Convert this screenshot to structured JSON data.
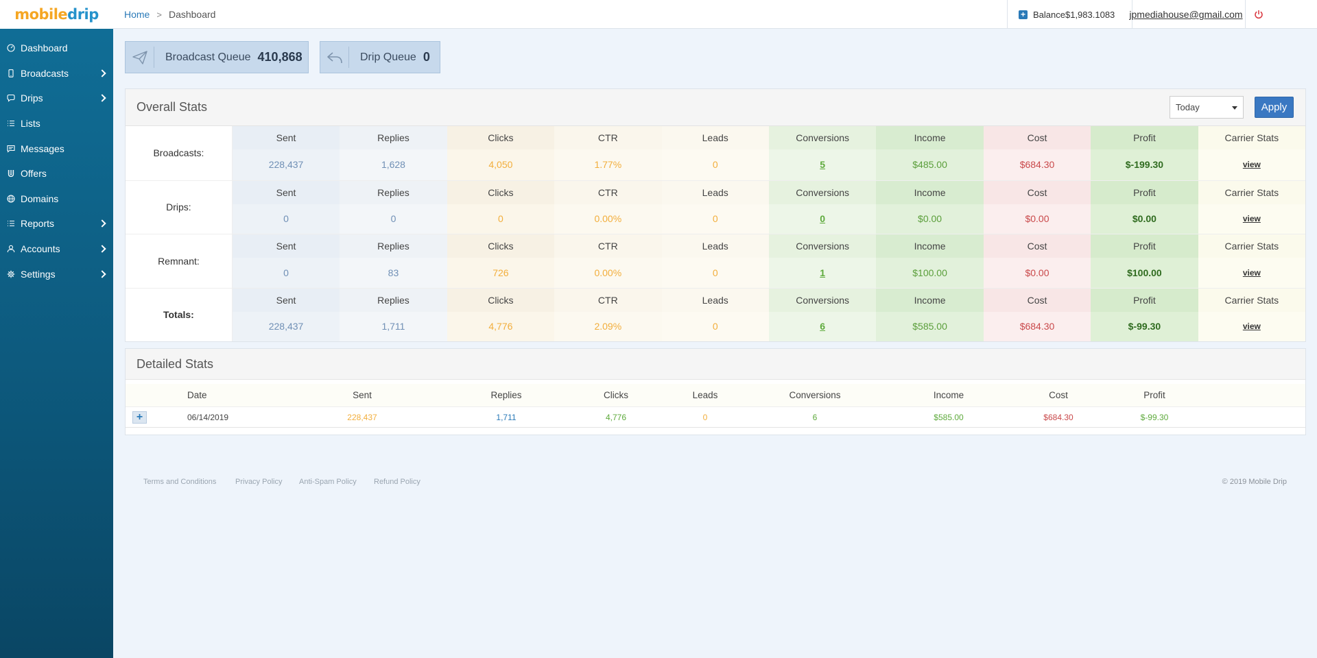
{
  "brand": {
    "logo_part1": "mobile",
    "logo_part2": "drip"
  },
  "sidebar": {
    "items": [
      {
        "label": "Dashboard",
        "icon": "gauge-icon",
        "has_submenu": false
      },
      {
        "label": "Broadcasts",
        "icon": "mobile-icon",
        "has_submenu": true
      },
      {
        "label": "Drips",
        "icon": "chat-icon",
        "has_submenu": true
      },
      {
        "label": "Lists",
        "icon": "list-icon",
        "has_submenu": false
      },
      {
        "label": "Messages",
        "icon": "message-icon",
        "has_submenu": false
      },
      {
        "label": "Offers",
        "icon": "magnet-icon",
        "has_submenu": false
      },
      {
        "label": "Domains",
        "icon": "globe-icon",
        "has_submenu": false
      },
      {
        "label": "Reports",
        "icon": "list-icon",
        "has_submenu": true
      },
      {
        "label": "Accounts",
        "icon": "user-icon",
        "has_submenu": true
      },
      {
        "label": "Settings",
        "icon": "gear-icon",
        "has_submenu": true
      }
    ]
  },
  "header": {
    "breadcrumb": {
      "home": "Home",
      "separator": ">",
      "current": "Dashboard"
    },
    "balance_label": "Balance ",
    "balance_value": "$1,983.1083",
    "email": "jpmediahouse@gmail.com"
  },
  "queues": {
    "broadcast": {
      "label": "Broadcast Queue",
      "value": "410,868"
    },
    "drip": {
      "label": "Drip Queue",
      "value": "0"
    }
  },
  "overall": {
    "title": "Overall Stats",
    "date_select": {
      "selected": "Today"
    },
    "apply_label": "Apply",
    "headers": [
      "Sent",
      "Replies",
      "Clicks",
      "CTR",
      "Leads",
      "Conversions",
      "Income",
      "Cost",
      "Profit",
      "Carrier Stats"
    ],
    "rows": [
      {
        "label": "Broadcasts:",
        "values": [
          "228,437",
          "1,628",
          "4,050",
          "1.77%",
          "0",
          "5",
          "$485.00",
          "$684.30",
          "$-199.30",
          "view"
        ]
      },
      {
        "label": "Drips:",
        "values": [
          "0",
          "0",
          "0",
          "0.00%",
          "0",
          "0",
          "$0.00",
          "$0.00",
          "$0.00",
          "view"
        ]
      },
      {
        "label": "Remnant:",
        "values": [
          "0",
          "83",
          "726",
          "0.00%",
          "0",
          "1",
          "$100.00",
          "$0.00",
          "$100.00",
          "view"
        ]
      },
      {
        "label": "Totals:",
        "values": [
          "228,437",
          "1,711",
          "4,776",
          "2.09%",
          "0",
          "6",
          "$585.00",
          "$684.30",
          "$-99.30",
          "view"
        ]
      }
    ]
  },
  "detailed": {
    "title": "Detailed Stats",
    "headers": [
      "Date",
      "Sent",
      "Replies",
      "Clicks",
      "Leads",
      "Conversions",
      "Income",
      "Cost",
      "Profit"
    ],
    "rows": [
      {
        "expand_label": "+",
        "values": [
          "06/14/2019",
          "228,437",
          "1,711",
          "4,776",
          "0",
          "6",
          "$585.00",
          "$684.30",
          "$-99.30"
        ]
      }
    ]
  },
  "footer": {
    "links": [
      "Terms and Conditions",
      "Privacy Policy",
      "Anti-Spam Policy",
      "Refund Policy"
    ],
    "copyright": "© 2019 Mobile Drip"
  },
  "colors": {
    "sidebar": "#0d5a7e",
    "accent": "#3a78c2",
    "orange": "#f2ae3c",
    "green": "#5eaa3c",
    "red": "#c9484a"
  }
}
